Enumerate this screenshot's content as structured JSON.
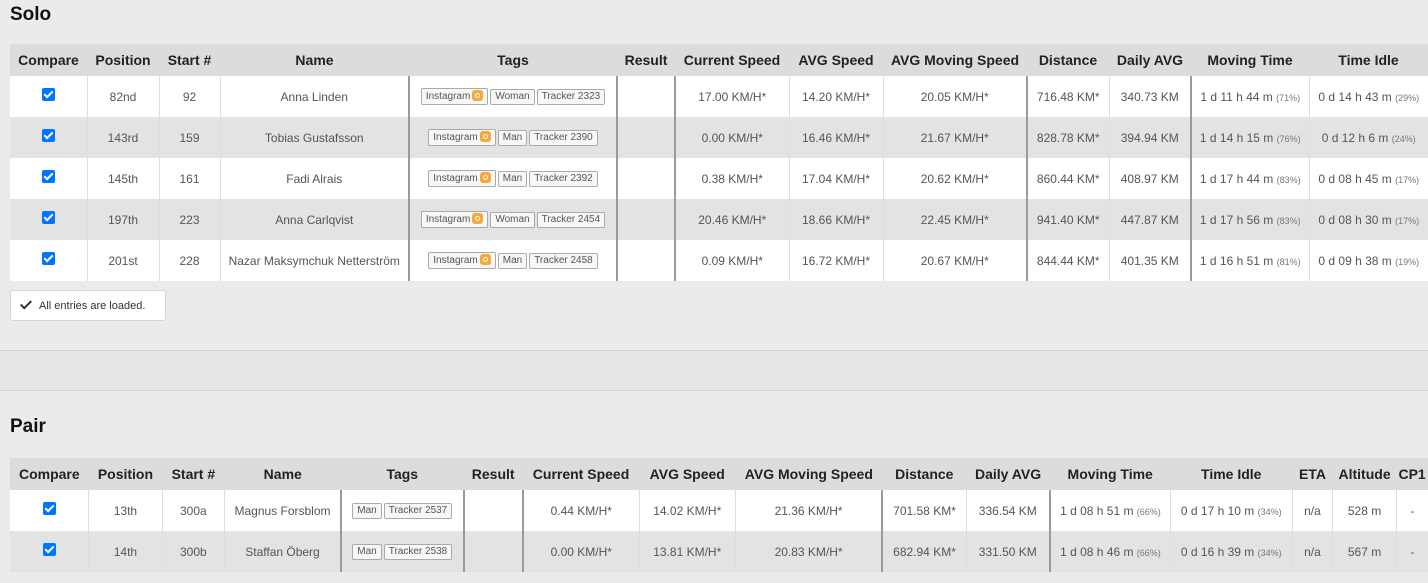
{
  "solo": {
    "title": "Solo",
    "headers": [
      "Compare",
      "Position",
      "Start #",
      "Name",
      "Tags",
      "Result",
      "Current Speed",
      "AVG Speed",
      "AVG Moving Speed",
      "Distance",
      "Daily AVG",
      "Moving Time",
      "Time Idle"
    ],
    "rows": [
      {
        "position": "82nd",
        "start": "92",
        "name": "Anna Linden",
        "tags": [
          "Instagram",
          "Woman",
          "Tracker 2323"
        ],
        "result": "",
        "current_speed": "17.00 KM/H*",
        "avg_speed": "14.20 KM/H*",
        "avg_moving_speed": "20.05 KM/H*",
        "distance": "716.48 KM*",
        "daily_avg": "340.73 KM",
        "moving_time": "1 d 11 h 44 m",
        "moving_pct": "(71%)",
        "time_idle": "0 d 14 h 43 m",
        "idle_pct": "(29%)"
      },
      {
        "position": "143rd",
        "start": "159",
        "name": "Tobias Gustafsson",
        "tags": [
          "Instagram",
          "Man",
          "Tracker 2390"
        ],
        "result": "",
        "current_speed": "0.00 KM/H*",
        "avg_speed": "16.46 KM/H*",
        "avg_moving_speed": "21.67 KM/H*",
        "distance": "828.78 KM*",
        "daily_avg": "394.94 KM",
        "moving_time": "1 d 14 h 15 m",
        "moving_pct": "(76%)",
        "time_idle": "0 d 12 h 6 m",
        "idle_pct": "(24%)"
      },
      {
        "position": "145th",
        "start": "161",
        "name": "Fadi Alrais",
        "tags": [
          "Instagram",
          "Man",
          "Tracker 2392"
        ],
        "result": "",
        "current_speed": "0.38 KM/H*",
        "avg_speed": "17.04 KM/H*",
        "avg_moving_speed": "20.62 KM/H*",
        "distance": "860.44 KM*",
        "daily_avg": "408.97 KM",
        "moving_time": "1 d 17 h 44 m",
        "moving_pct": "(83%)",
        "time_idle": "0 d 08 h 45 m",
        "idle_pct": "(17%)"
      },
      {
        "position": "197th",
        "start": "223",
        "name": "Anna Carlqvist",
        "tags": [
          "Instagram",
          "Woman",
          "Tracker 2454"
        ],
        "result": "",
        "current_speed": "20.46 KM/H*",
        "avg_speed": "18.66 KM/H*",
        "avg_moving_speed": "22.45 KM/H*",
        "distance": "941.40 KM*",
        "daily_avg": "447.87 KM",
        "moving_time": "1 d 17 h 56 m",
        "moving_pct": "(83%)",
        "time_idle": "0 d 08 h 30 m",
        "idle_pct": "(17%)"
      },
      {
        "position": "201st",
        "start": "228",
        "name": "Nazar Maksymchuk Netterström",
        "tags": [
          "Instagram",
          "Man",
          "Tracker 2458"
        ],
        "result": "",
        "current_speed": "0.09 KM/H*",
        "avg_speed": "16.72 KM/H*",
        "avg_moving_speed": "20.67 KM/H*",
        "distance": "844.44 KM*",
        "daily_avg": "401.35 KM",
        "moving_time": "1 d 16 h 51 m",
        "moving_pct": "(81%)",
        "time_idle": "0 d 09 h 38 m",
        "idle_pct": "(19%)"
      }
    ],
    "status": "All entries are loaded."
  },
  "pair": {
    "title": "Pair",
    "headers": [
      "Compare",
      "Position",
      "Start #",
      "Name",
      "Tags",
      "Result",
      "Current Speed",
      "AVG Speed",
      "AVG Moving Speed",
      "Distance",
      "Daily AVG",
      "Moving Time",
      "Time Idle",
      "ETA",
      "Altitude",
      "CP1"
    ],
    "rows": [
      {
        "position": "13th",
        "start": "300a",
        "name": "Magnus Forsblom",
        "tags": [
          "Man",
          "Tracker 2537"
        ],
        "result": "",
        "current_speed": "0.44 KM/H*",
        "avg_speed": "14.02 KM/H*",
        "avg_moving_speed": "21.36 KM/H*",
        "distance": "701.58 KM*",
        "daily_avg": "336.54 KM",
        "moving_time": "1 d 08 h 51 m",
        "moving_pct": "(66%)",
        "time_idle": "0 d 17 h 10 m",
        "idle_pct": "(34%)",
        "eta": "n/a",
        "altitude": "528 m",
        "cp1": "-"
      },
      {
        "position": "14th",
        "start": "300b",
        "name": "Staffan Öberg",
        "tags": [
          "Man",
          "Tracker 2538"
        ],
        "result": "",
        "current_speed": "0.00 KM/H*",
        "avg_speed": "13.81 KM/H*",
        "avg_moving_speed": "20.83 KM/H*",
        "distance": "682.94 KM*",
        "daily_avg": "331.50 KM",
        "moving_time": "1 d 08 h 46 m",
        "moving_pct": "(66%)",
        "time_idle": "0 d 16 h 39 m",
        "idle_pct": "(34%)",
        "eta": "n/a",
        "altitude": "567 m",
        "cp1": "-"
      }
    ]
  },
  "colors": {
    "checkbox": "#0075ff",
    "instagram": "#f6a93b"
  }
}
